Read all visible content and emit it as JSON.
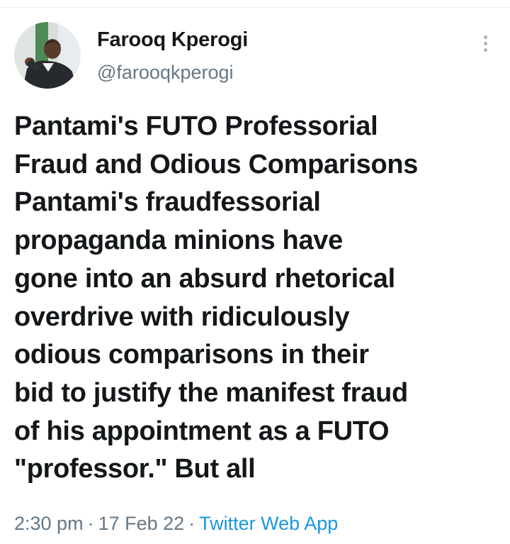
{
  "tweet": {
    "author": {
      "name": "Farooq Kperogi",
      "handle": "@farooqkperogi",
      "avatar_icon": "profile-photo"
    },
    "more_icon": "vertical-dots-icon",
    "text_lines": [
      "Pantami's FUTO Professorial",
      "Fraud and Odious Comparisons",
      "Pantami's fraudfessorial",
      "propaganda minions have",
      "gone into an absurd rhetorical",
      "overdrive with ridiculously",
      "odious comparisons in their",
      "bid to justify the manifest fraud",
      "of his appointment as a FUTO",
      "\"professor.\" But all"
    ],
    "meta": {
      "time": "2:30 pm",
      "separator": "·",
      "date": "17 Feb 22",
      "source": "Twitter Web App"
    }
  },
  "colors": {
    "text": "#14171a",
    "secondary": "#657786",
    "link": "#1b95e0"
  }
}
